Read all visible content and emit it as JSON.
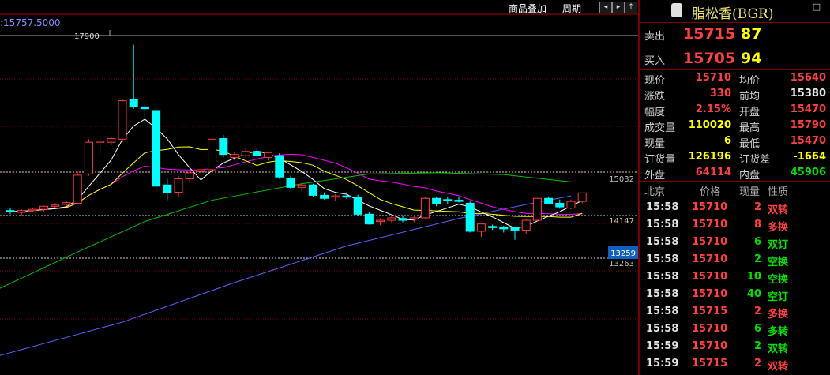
{
  "chart": {
    "ma_readout": ":15757.5000",
    "links": {
      "overlay": "商品叠加",
      "period": "周期"
    },
    "nav_icons": [
      "prev-arrow",
      "next-arrow",
      "zoom-in",
      "zoom-out"
    ],
    "price_labels": {
      "high_marker": "17900",
      "line_a": "15032",
      "line_b": "14147",
      "line_c": "13263",
      "current_box": "13259"
    },
    "colors": {
      "up": "#ff3c3c",
      "down": "#00ffff",
      "ma5": "#ffffff",
      "ma10": "#ffff00",
      "ma20": "#ff00ff",
      "ma40": "#00c000",
      "ma60": "#6060ff",
      "grid": "#8a0000"
    }
  },
  "chart_data": {
    "type": "candlestick",
    "y_range": [
      12600,
      18050
    ],
    "candles": [
      [
        15180,
        15230,
        15120,
        15160
      ],
      [
        15150,
        15200,
        15100,
        15180
      ],
      [
        15180,
        15230,
        15150,
        15200
      ],
      [
        15200,
        15260,
        15170,
        15250
      ],
      [
        15250,
        15300,
        15220,
        15270
      ],
      [
        15280,
        15330,
        15250,
        15310
      ],
      [
        15300,
        15820,
        15280,
        15760
      ],
      [
        15780,
        16350,
        15750,
        16300
      ],
      [
        16300,
        16380,
        16100,
        16320
      ],
      [
        16300,
        16400,
        16250,
        16360
      ],
      [
        16350,
        17000,
        16300,
        16980
      ],
      [
        17000,
        17900,
        16850,
        16880
      ],
      [
        16880,
        16950,
        16600,
        16850
      ],
      [
        16820,
        16900,
        15500,
        15580
      ],
      [
        15600,
        15700,
        15350,
        15480
      ],
      [
        15480,
        15750,
        15400,
        15700
      ],
      [
        15700,
        15850,
        15650,
        15800
      ],
      [
        15820,
        15900,
        15780,
        15850
      ],
      [
        15850,
        16380,
        15800,
        16350
      ],
      [
        16360,
        16420,
        16050,
        16100
      ],
      [
        16050,
        16150,
        16000,
        16100
      ],
      [
        16080,
        16200,
        16050,
        16150
      ],
      [
        16150,
        16220,
        16000,
        16080
      ],
      [
        16050,
        16150,
        16000,
        16130
      ],
      [
        16080,
        16120,
        15700,
        15730
      ],
      [
        15700,
        15750,
        15530,
        15560
      ],
      [
        15560,
        15640,
        15480,
        15600
      ],
      [
        15600,
        15620,
        15400,
        15430
      ],
      [
        15430,
        15480,
        15360,
        15380
      ],
      [
        15400,
        15450,
        15330,
        15420
      ],
      [
        15420,
        15480,
        15370,
        15400
      ],
      [
        15400,
        15440,
        15100,
        15120
      ],
      [
        15120,
        15160,
        14950,
        14960
      ],
      [
        15000,
        15050,
        14940,
        15020
      ],
      [
        15020,
        15080,
        14990,
        15060
      ],
      [
        15050,
        15100,
        14990,
        15020
      ],
      [
        15040,
        15100,
        14990,
        15060
      ],
      [
        15060,
        15400,
        15040,
        15380
      ],
      [
        15380,
        15410,
        15250,
        15300
      ],
      [
        15360,
        15400,
        15280,
        15350
      ],
      [
        15350,
        15400,
        15310,
        15330
      ],
      [
        15300,
        15330,
        14820,
        14840
      ],
      [
        14840,
        14950,
        14750,
        14960
      ],
      [
        14920,
        14950,
        14860,
        14900
      ],
      [
        14900,
        14930,
        14820,
        14880
      ],
      [
        14900,
        14920,
        14700,
        14860
      ],
      [
        14860,
        15050,
        14800,
        15020
      ],
      [
        15020,
        15390,
        15000,
        15380
      ],
      [
        15380,
        15410,
        15290,
        15300
      ],
      [
        15300,
        15360,
        15210,
        15240
      ],
      [
        15220,
        15360,
        15200,
        15330
      ],
      [
        15330,
        15470,
        15300,
        15470
      ]
    ],
    "current_price": 15710
  },
  "panel": {
    "title": "脂松香(BGR)",
    "sell": {
      "label": "卖出",
      "price": "15715",
      "qty": "87"
    },
    "buy": {
      "label": "买入",
      "price": "15705",
      "qty": "94"
    },
    "stats": [
      {
        "l1": "现价",
        "v1": "15710",
        "c1": "red",
        "l2": "均价",
        "v2": "15640",
        "c2": "red"
      },
      {
        "l1": "涨跌",
        "v1": "330",
        "c1": "red",
        "l2": "前均",
        "v2": "15380",
        "c2": "white"
      },
      {
        "l1": "幅度",
        "v1": "2.15%",
        "c1": "red",
        "l2": "开盘",
        "v2": "15470",
        "c2": "red"
      },
      {
        "l1": "成交量",
        "v1": "110020",
        "c1": "yellow",
        "l2": "最高",
        "v2": "15790",
        "c2": "red"
      },
      {
        "l1": "现量",
        "v1": "6",
        "c1": "yellow",
        "l2": "最低",
        "v2": "15470",
        "c2": "red"
      },
      {
        "l1": "订货量",
        "v1": "126196",
        "c1": "yellow",
        "l2": "订货差",
        "v2": "-1664",
        "c2": "yellow"
      },
      {
        "l1": "外盘",
        "v1": "64114",
        "c1": "red",
        "l2": "内盘",
        "v2": "45906",
        "c2": "green"
      }
    ],
    "tick_header": {
      "time": "北京",
      "price": "价格",
      "vol": "现量",
      "nature": "性质"
    },
    "ticks": [
      {
        "time": "15:58",
        "price": "15710",
        "vol": "2",
        "vc": "red",
        "nature": "双转",
        "nc": "red"
      },
      {
        "time": "15:58",
        "price": "15710",
        "vol": "8",
        "vc": "red",
        "nature": "多换",
        "nc": "red"
      },
      {
        "time": "15:58",
        "price": "15710",
        "vol": "6",
        "vc": "green",
        "nature": "双订",
        "nc": "green"
      },
      {
        "time": "15:58",
        "price": "15710",
        "vol": "2",
        "vc": "green",
        "nature": "空换",
        "nc": "green"
      },
      {
        "time": "15:58",
        "price": "15710",
        "vol": "10",
        "vc": "green",
        "nature": "空换",
        "nc": "green"
      },
      {
        "time": "15:58",
        "price": "15710",
        "vol": "40",
        "vc": "green",
        "nature": "空订",
        "nc": "green"
      },
      {
        "time": "15:58",
        "price": "15715",
        "vol": "2",
        "vc": "red",
        "nature": "多换",
        "nc": "red"
      },
      {
        "time": "15:58",
        "price": "15710",
        "vol": "6",
        "vc": "green",
        "nature": "多转",
        "nc": "green"
      },
      {
        "time": "15:59",
        "price": "15710",
        "vol": "2",
        "vc": "green",
        "nature": "双转",
        "nc": "green"
      },
      {
        "time": "15:59",
        "price": "15715",
        "vol": "2",
        "vc": "red",
        "nature": "双转",
        "nc": "red"
      }
    ]
  }
}
